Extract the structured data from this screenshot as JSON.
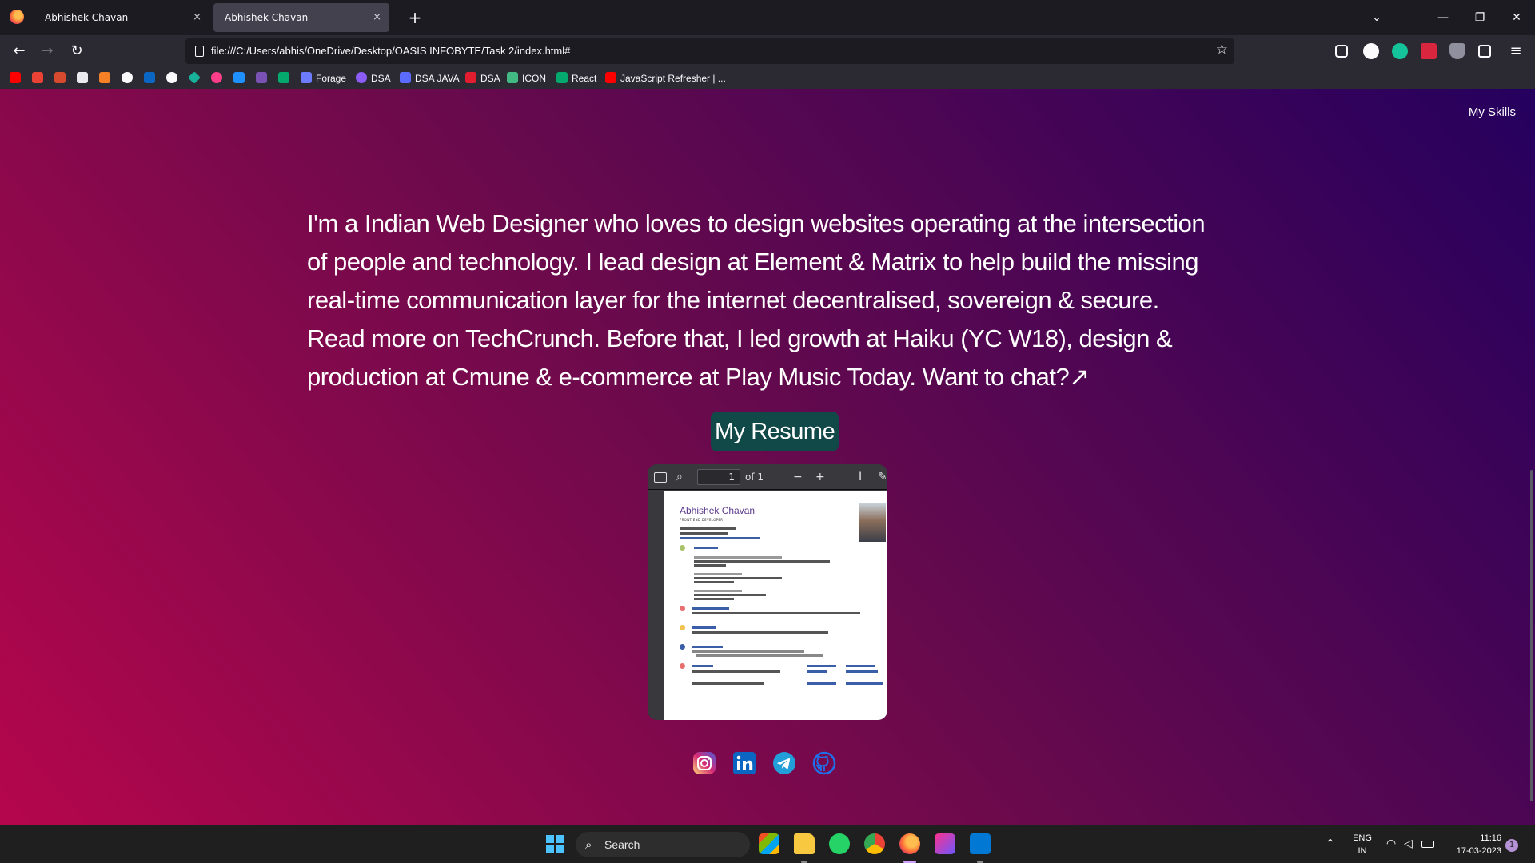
{
  "browser": {
    "tabs": [
      {
        "title": "Abhishek Chavan",
        "active": false
      },
      {
        "title": "Abhishek Chavan",
        "active": true
      }
    ],
    "close_glyph": "×",
    "new_tab_glyph": "+",
    "url": "file:///C:/Users/abhis/OneDrive/Desktop/OASIS INFOBYTE/Task 2/index.html#",
    "bookmarks": [
      {
        "label": "Forage",
        "icon": "forage-icon",
        "color": "#6d7cff"
      },
      {
        "label": "DSA",
        "icon": "dsa-icon",
        "color": "#8b5cf6"
      },
      {
        "label": "DSA JAVA",
        "icon": "dsa-java-icon",
        "color": "#5b6bff"
      },
      {
        "label": "DSA",
        "icon": "codechef-icon",
        "color": "#e11d2f"
      },
      {
        "label": "ICON",
        "icon": "vue-icon",
        "color": "#42b883"
      },
      {
        "label": "React",
        "icon": "w3-icon",
        "color": "#04aa6d"
      },
      {
        "label": "JavaScript Refresher | ...",
        "icon": "youtube-icon",
        "color": "#ff0000"
      }
    ]
  },
  "page": {
    "nav_link": "My Skills",
    "intro": "I'm a Indian Web Designer who loves to design websites operating at the intersection of people and technology. I lead design at Element & Matrix to help build the missing real-time communication layer for the internet decentralised, sovereign & secure. Read more on TechCrunch. Before that, I led growth at Haiku (YC W18), design & production at Cmune & e-commerce at Play Music Today. Want to chat?↗",
    "resume_button": "My Resume",
    "pdf_viewer": {
      "page_number": "1",
      "page_count": "of 1",
      "zoom_out": "−",
      "zoom_in": "+",
      "resume_name": "Abhishek Chavan",
      "resume_role": "FRONT END DEVELOPER"
    },
    "socials": [
      {
        "name": "instagram-icon",
        "color": "#e1306c"
      },
      {
        "name": "linkedin-icon",
        "color": "#0a66c2"
      },
      {
        "name": "telegram-icon",
        "color": "#229ed9"
      },
      {
        "name": "github-icon",
        "color": "#1f6feb"
      }
    ]
  },
  "taskbar": {
    "search_placeholder": "Search",
    "language": "ENG",
    "region": "IN",
    "time": "11:16",
    "date": "17-03-2023",
    "notifications": "1"
  },
  "colors": {
    "resume_button_bg": "#114949",
    "gradient_start": "#b5064c",
    "gradient_end": "#25005e"
  }
}
